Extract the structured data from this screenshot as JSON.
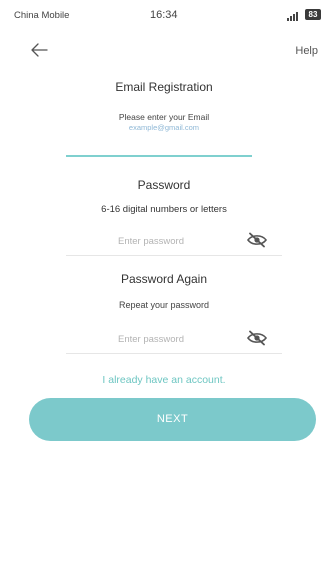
{
  "status_bar": {
    "carrier": "China Mobile",
    "time": "16:34",
    "battery": "83"
  },
  "nav": {
    "back_icon": "arrow-left-icon",
    "help_label": "Help"
  },
  "email_section": {
    "title": "Email Registration",
    "prompt": "Please enter your Email",
    "email_value": "example@gmail.com"
  },
  "password_section": {
    "title": "Password",
    "hint": "6-16 digital numbers or letters",
    "placeholder": "Enter password",
    "toggle_icon": "eye-off-icon"
  },
  "password_again_section": {
    "title": "Password Again",
    "hint": "Repeat your password",
    "placeholder": "Enter password",
    "toggle_icon": "eye-off-icon"
  },
  "login_link": "I already have an account.",
  "next_button": "NEXT",
  "colors": {
    "accent": "#7cc9cb",
    "link": "#6ec6c2",
    "email_text": "#8fb8d6"
  }
}
